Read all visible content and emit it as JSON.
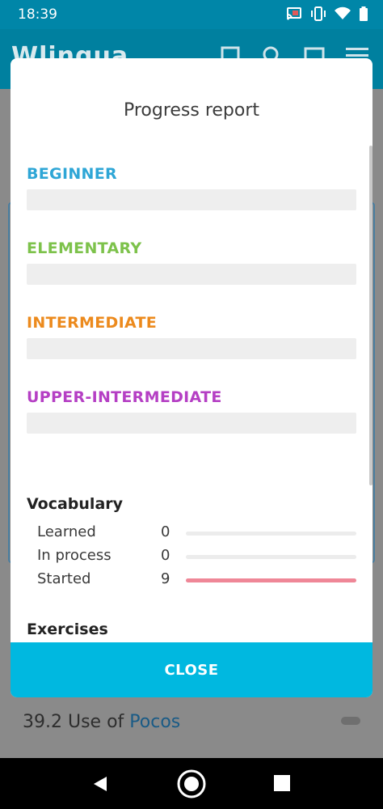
{
  "status_bar": {
    "time": "18:39",
    "icons": [
      "cast-icon",
      "vibrate-icon",
      "wifi-icon",
      "battery-icon"
    ]
  },
  "background_app": {
    "logo": "Wlingua",
    "header_icons": [
      "bookmark-icon",
      "search-icon",
      "image-icon",
      "menu-icon"
    ],
    "lesson": {
      "number": "39.2",
      "text": "Use of",
      "link": "Pocos"
    }
  },
  "dialog": {
    "title": "Progress report",
    "levels": [
      {
        "label": "BEGINNER",
        "color": "#2ea6d6",
        "progress": 0
      },
      {
        "label": "ELEMENTARY",
        "color": "#7dc24b",
        "progress": 0
      },
      {
        "label": "INTERMEDIATE",
        "color": "#ec8a1d",
        "progress": 0
      },
      {
        "label": "UPPER-INTERMEDIATE",
        "color": "#b53fc4",
        "progress": 0
      }
    ],
    "vocabulary": {
      "title": "Vocabulary",
      "rows": [
        {
          "label": "Learned",
          "value": "0",
          "progress": 0
        },
        {
          "label": "In process",
          "value": "0",
          "progress": 0
        },
        {
          "label": "Started",
          "value": "9",
          "progress": 1,
          "color": "#ef8797"
        }
      ]
    },
    "exercises_title": "Exercises",
    "close_label": "CLOSE"
  },
  "colors": {
    "accent": "#00b8e0",
    "header": "#0086a8"
  },
  "nav_bar": {
    "buttons": [
      "back-icon",
      "home-icon",
      "recents-icon"
    ]
  }
}
